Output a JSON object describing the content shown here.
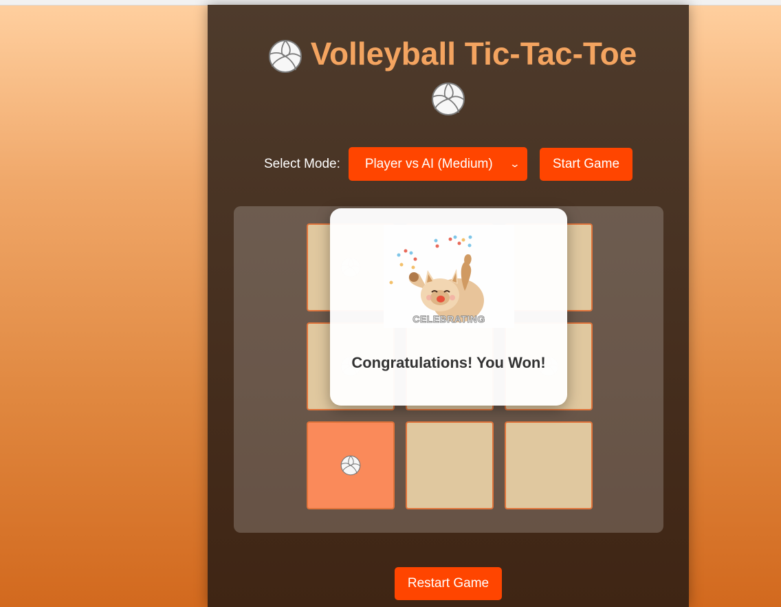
{
  "title": "Volleyball Tic-Tac-Toe",
  "mode": {
    "label": "Select Mode:",
    "selected": "Player vs AI (Medium)"
  },
  "buttons": {
    "start": "Start Game",
    "restart": "Restart Game"
  },
  "board": {
    "cells": [
      "volleyball",
      "",
      "",
      "volleyball",
      "",
      "volleyball",
      "volleyball",
      "",
      ""
    ],
    "winning_cell": 6
  },
  "modal": {
    "image_caption": "CELEBRATING",
    "message": "Congratulations! You Won!"
  },
  "colors": {
    "accent": "#ff4500",
    "title": "#f4a460",
    "cell": "#e0c89f",
    "winning_cell": "#fa8a5a"
  }
}
